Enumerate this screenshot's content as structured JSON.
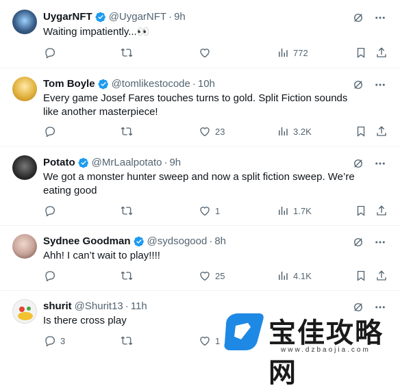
{
  "tweets": [
    {
      "name": "UygarNFT",
      "handle": "@UygarNFT",
      "time": "9h",
      "text": "Waiting impatiently...👀",
      "reply": "",
      "retweet": "",
      "like": "",
      "views": "772",
      "avatar_color": "#3a5f8a"
    },
    {
      "name": "Tom Boyle",
      "handle": "@tomlikestocode",
      "time": "10h",
      "text": "Every game Josef Fares touches turns to gold. Split Fiction sounds like another masterpiece!",
      "reply": "",
      "retweet": "",
      "like": "23",
      "views": "3.2K",
      "avatar_color": "#e0b13e"
    },
    {
      "name": "Potato",
      "handle": "@MrLaalpotato",
      "time": "9h",
      "text": "We got a monster hunter sweep and now a split fiction sweep. We’re eating good",
      "reply": "",
      "retweet": "",
      "like": "1",
      "views": "1.7K",
      "avatar_color": "#2b2b2b"
    },
    {
      "name": "Sydnee Goodman",
      "handle": "@sydsogood",
      "time": "8h",
      "text": "Ahh! I can’t wait to play!!!!",
      "reply": "",
      "retweet": "",
      "like": "25",
      "views": "4.1K",
      "avatar_color": "#c9a59a"
    },
    {
      "name": "shurit",
      "handle": "@Shurit13",
      "time": "11h",
      "text": "Is there cross play",
      "reply": "3",
      "retweet": "",
      "like": "1",
      "views": "",
      "avatar_color": "#f3f3f3"
    }
  ],
  "watermark": {
    "title": "宝佳攻略网",
    "url": "www.dzbaojia.com",
    "brand_color": "#1e88e5"
  },
  "colors": {
    "verified": "#1d9bf0",
    "muted": "#536471",
    "text": "#0f1419"
  }
}
